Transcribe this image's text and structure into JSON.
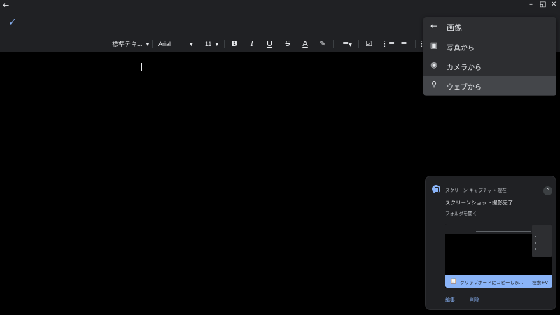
{
  "titlebar": {
    "back_icon": "arrow-left-icon",
    "minimize": "–",
    "restore": "◱",
    "close": "✕"
  },
  "appbar": {
    "done_icon": "check-icon"
  },
  "toolbar": {
    "style_label": "標準テキ...",
    "font_label": "Arial",
    "size_label": "11",
    "bold": "B",
    "italic": "I",
    "underline": "U",
    "strike": "S",
    "text_color": "A"
  },
  "image_menu": {
    "title": "画像",
    "items": [
      {
        "label": "写真から",
        "icon": "photo-icon"
      },
      {
        "label": "カメラから",
        "icon": "camera-icon"
      },
      {
        "label": "ウェブから",
        "icon": "search-icon"
      }
    ]
  },
  "notification": {
    "source": "スクリーン キャプチャ • 現在",
    "title": "スクリーンショット撮影完了",
    "subtitle": "フォルダを開く",
    "clipboard_text": "クリップボードにコピーしま...",
    "clipboard_shortcut": "検索+V",
    "edit": "編集",
    "delete": "削除"
  },
  "colors": {
    "accent": "#8ab4f8",
    "surface": "#202124",
    "menu": "#2d2e31"
  }
}
